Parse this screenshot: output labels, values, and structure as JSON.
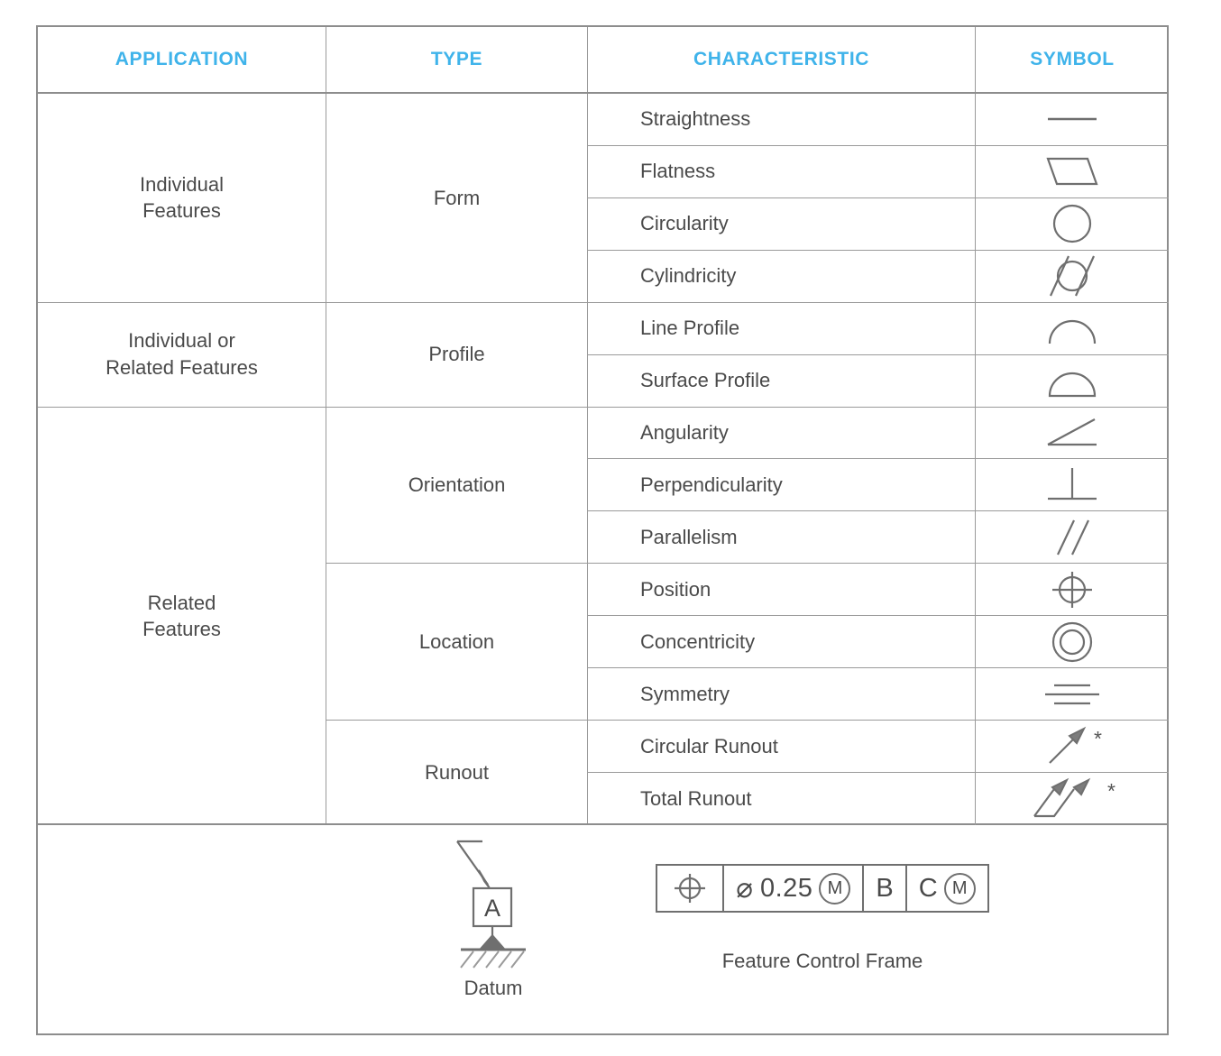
{
  "table": {
    "headers": [
      "APPLICATION",
      "TYPE",
      "CHARACTERISTIC",
      "SYMBOL"
    ],
    "accent_color": "#3fb3ea",
    "border_color": "#8d8d8d",
    "text_color": "#4a4a4a",
    "applications": [
      {
        "label": "Individual\nFeatures",
        "rowspan": 4
      },
      {
        "label": "Individual or\nRelated Features",
        "rowspan": 2
      },
      {
        "label": "Related\nFeatures",
        "rowspan": 8
      }
    ],
    "types": [
      {
        "label": "Form",
        "rowspan": 4
      },
      {
        "label": "Profile",
        "rowspan": 2
      },
      {
        "label": "Orientation",
        "rowspan": 3
      },
      {
        "label": "Location",
        "rowspan": 3
      },
      {
        "label": "Runout",
        "rowspan": 2
      }
    ],
    "rows": [
      {
        "characteristic": "Straightness",
        "symbol": "straightness-symbol",
        "note": ""
      },
      {
        "characteristic": "Flatness",
        "symbol": "flatness-symbol",
        "note": ""
      },
      {
        "characteristic": "Circularity",
        "symbol": "circularity-symbol",
        "note": ""
      },
      {
        "characteristic": "Cylindricity",
        "symbol": "cylindricity-symbol",
        "note": ""
      },
      {
        "characteristic": "Line Profile",
        "symbol": "line-profile-symbol",
        "note": ""
      },
      {
        "characteristic": "Surface Profile",
        "symbol": "surface-profile-symbol",
        "note": ""
      },
      {
        "characteristic": "Angularity",
        "symbol": "angularity-symbol",
        "note": ""
      },
      {
        "characteristic": "Perpendicularity",
        "symbol": "perpendicularity-symbol",
        "note": ""
      },
      {
        "characteristic": "Parallelism",
        "symbol": "parallelism-symbol",
        "note": ""
      },
      {
        "characteristic": "Position",
        "symbol": "position-symbol",
        "note": ""
      },
      {
        "characteristic": "Concentricity",
        "symbol": "concentricity-symbol",
        "note": ""
      },
      {
        "characteristic": "Symmetry",
        "symbol": "symmetry-symbol",
        "note": ""
      },
      {
        "characteristic": "Circular Runout",
        "symbol": "circular-runout-symbol",
        "note": "*"
      },
      {
        "characteristic": "Total Runout",
        "symbol": "total-runout-symbol",
        "note": "*"
      }
    ]
  },
  "footer": {
    "datum": {
      "label": "Datum",
      "letter": "A"
    },
    "feature_control_frame": {
      "label": "Feature Control Frame",
      "segments": [
        {
          "kind": "symbol",
          "symbol": "position-symbol"
        },
        {
          "kind": "tolerance",
          "diameter": "⌀",
          "value": "0.25",
          "modifier": "M"
        },
        {
          "kind": "datum",
          "value": "B"
        },
        {
          "kind": "datum",
          "value": "C",
          "modifier": "M"
        }
      ]
    }
  }
}
